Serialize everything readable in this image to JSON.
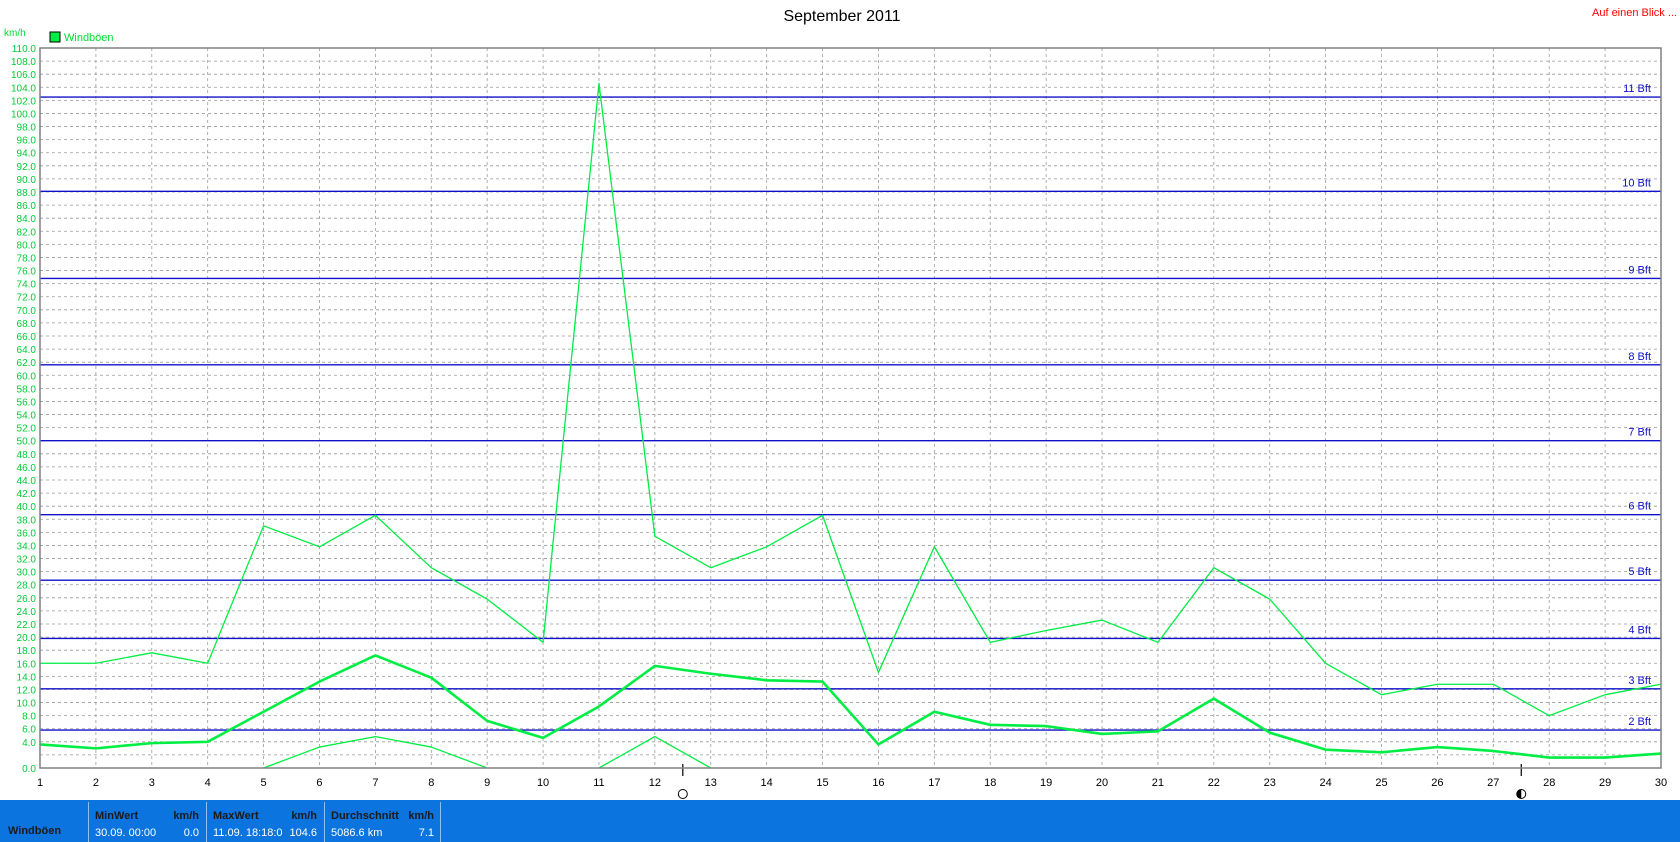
{
  "header": {
    "title": "September 2011",
    "top_link": "Auf einen Blick ..."
  },
  "colors": {
    "series": "#00ee44",
    "beaufort": "#1010cc",
    "grid": "#9a9a9a",
    "stats_bar": "#0b74df"
  },
  "chart_data": {
    "type": "line",
    "title": "September 2011",
    "ylabel": "km/h",
    "ylim": [
      0,
      110
    ],
    "xlim": [
      1,
      30
    ],
    "y_tick_step": 2,
    "y_tick_labels": [
      "0.0",
      "4.0",
      "6.0",
      "8.0",
      "10.0",
      "12.0",
      "14.0",
      "16.0",
      "18.0",
      "20.0",
      "22.0",
      "24.0",
      "26.0",
      "28.0",
      "30.0",
      "32.0",
      "34.0",
      "36.0",
      "38.0",
      "40.0",
      "42.0",
      "44.0",
      "46.0",
      "48.0",
      "50.0",
      "52.0",
      "54.0",
      "56.0",
      "58.0",
      "60.0",
      "62.0",
      "64.0",
      "66.0",
      "68.0",
      "70.0",
      "72.0",
      "74.0",
      "76.0",
      "78.0",
      "80.0",
      "82.0",
      "84.0",
      "86.0",
      "88.0",
      "90.0",
      "92.0",
      "94.0",
      "96.0",
      "98.0",
      "100.0",
      "102.0",
      "104.0",
      "106.0",
      "108.0",
      "110.0"
    ],
    "x": [
      1,
      2,
      3,
      4,
      5,
      6,
      7,
      8,
      9,
      10,
      11,
      12,
      13,
      14,
      15,
      16,
      17,
      18,
      19,
      20,
      21,
      22,
      23,
      24,
      25,
      26,
      27,
      28,
      29,
      30
    ],
    "x_tick_labels": [
      "1",
      "2",
      "3",
      "4",
      "5",
      "6",
      "7",
      "8",
      "9",
      "10",
      "11",
      "12",
      "13",
      "14",
      "15",
      "16",
      "17",
      "18",
      "19",
      "20",
      "21",
      "22",
      "23",
      "24",
      "25",
      "26",
      "27",
      "28",
      "29",
      "30"
    ],
    "legend": {
      "position": "top-left",
      "label": "Windböen"
    },
    "grid": true,
    "series": [
      {
        "name": "Windböen",
        "role": "max",
        "values": [
          16,
          16,
          17.6,
          16,
          37,
          33.8,
          38.6,
          30.6,
          25.8,
          19.2,
          104.6,
          35.4,
          30.6,
          33.8,
          38.6,
          14.6,
          33.8,
          19.2,
          21,
          22.6,
          19.2,
          30.6,
          25.8,
          16,
          11.2,
          12.8,
          12.8,
          8,
          11.2,
          12.8
        ]
      },
      {
        "name": "Windböen",
        "role": "average",
        "values": [
          3.6,
          3,
          3.8,
          4,
          8.6,
          13.2,
          17.2,
          13.8,
          7.2,
          4.6,
          9.4,
          15.6,
          14.4,
          13.4,
          13.2,
          3.6,
          8.6,
          6.6,
          6.4,
          5.2,
          5.6,
          10.6,
          5.4,
          2.8,
          2.4,
          3.2,
          2.6,
          1.6,
          1.6,
          2.2
        ]
      },
      {
        "name": "Windböen",
        "role": "min",
        "values": [
          null,
          null,
          null,
          null,
          0,
          3.2,
          4.8,
          3.2,
          0,
          null,
          0,
          4.8,
          0,
          null,
          null,
          null,
          null,
          null,
          null,
          null,
          null,
          null,
          null,
          null,
          null,
          null,
          null,
          null,
          null,
          null
        ]
      }
    ],
    "beaufort_lines": [
      {
        "label": "2 Bft",
        "value": 5.8
      },
      {
        "label": "3 Bft",
        "value": 12.1
      },
      {
        "label": "4 Bft",
        "value": 19.8
      },
      {
        "label": "5 Bft",
        "value": 28.7
      },
      {
        "label": "6 Bft",
        "value": 38.7
      },
      {
        "label": "7 Bft",
        "value": 50.0
      },
      {
        "label": "8 Bft",
        "value": 61.6
      },
      {
        "label": "9 Bft",
        "value": 74.8
      },
      {
        "label": "10 Bft",
        "value": 88.1
      },
      {
        "label": "11 Bft",
        "value": 102.5
      }
    ],
    "moon_phases": [
      {
        "day": 12.5,
        "icon": "full-moon-icon"
      },
      {
        "day": 27.5,
        "icon": "half-moon-icon"
      }
    ]
  },
  "stats": {
    "row_label": "Windböen",
    "cells": [
      {
        "head": "MinWert",
        "unit": "km/h",
        "left": "30.09.  00:00",
        "right": "0.0"
      },
      {
        "head": "MaxWert",
        "unit": "km/h",
        "left": "11.09.  18:18:0",
        "right": "104.6"
      },
      {
        "head": "Durchschnitt",
        "unit": "km/h",
        "left": "5086.6 km",
        "right": "7.1"
      }
    ]
  }
}
